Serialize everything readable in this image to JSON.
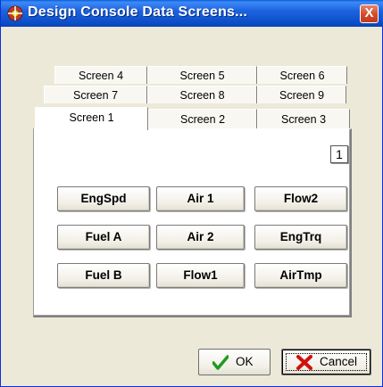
{
  "window": {
    "title": "Design Console Data Screens...",
    "close_label": "X"
  },
  "tabs": {
    "row_top": [
      "Screen 4",
      "Screen 5",
      "Screen 6"
    ],
    "row_middle": [
      "Screen 7",
      "Screen 8",
      "Screen 9"
    ],
    "row_front": [
      "Screen 1",
      "Screen 2",
      "Screen 3"
    ],
    "selected": "Screen 1"
  },
  "panel": {
    "page_number": "1",
    "buttons": [
      [
        "EngSpd",
        "Air 1",
        "Flow2"
      ],
      [
        "Fuel A",
        "Air 2",
        "EngTrq"
      ],
      [
        "Fuel B",
        "Flow1",
        "AirTmp"
      ]
    ]
  },
  "footer": {
    "ok_label": "OK",
    "cancel_label": "Cancel"
  },
  "colors": {
    "titlebar": "#0a4cc5",
    "window_bg": "#ece9d8",
    "ok_check": "#1f9b1f",
    "cancel_x": "#d01010"
  }
}
